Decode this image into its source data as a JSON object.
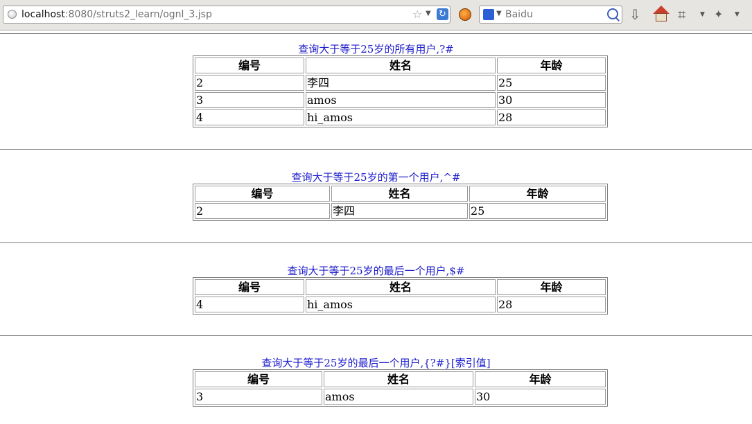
{
  "browser": {
    "url_host": "localhost",
    "url_rest": ":8080/struts2_learn/ognl_3.jsp",
    "search_placeholder": "Baidu"
  },
  "sections": [
    {
      "caption": "查询大于等于25岁的所有用户,?#",
      "headers": [
        "编号",
        "姓名",
        "年龄"
      ],
      "rows": [
        [
          "2",
          "李四",
          "25"
        ],
        [
          "3",
          "amos",
          "30"
        ],
        [
          "4",
          "hi_amos",
          "28"
        ]
      ]
    },
    {
      "caption": "查询大于等于25岁的第一个用户,^#",
      "headers": [
        "编号",
        "姓名",
        "年龄"
      ],
      "rows": [
        [
          "2",
          "李四",
          "25"
        ]
      ]
    },
    {
      "caption": "查询大于等于25岁的最后一个用户,$#",
      "headers": [
        "编号",
        "姓名",
        "年龄"
      ],
      "rows": [
        [
          "4",
          "hi_amos",
          "28"
        ]
      ]
    },
    {
      "caption": "查询大于等于25岁的最后一个用户,{?#}[索引值]",
      "headers": [
        "编号",
        "姓名",
        "年龄"
      ],
      "rows": [
        [
          "3",
          "amos",
          "30"
        ]
      ]
    }
  ]
}
